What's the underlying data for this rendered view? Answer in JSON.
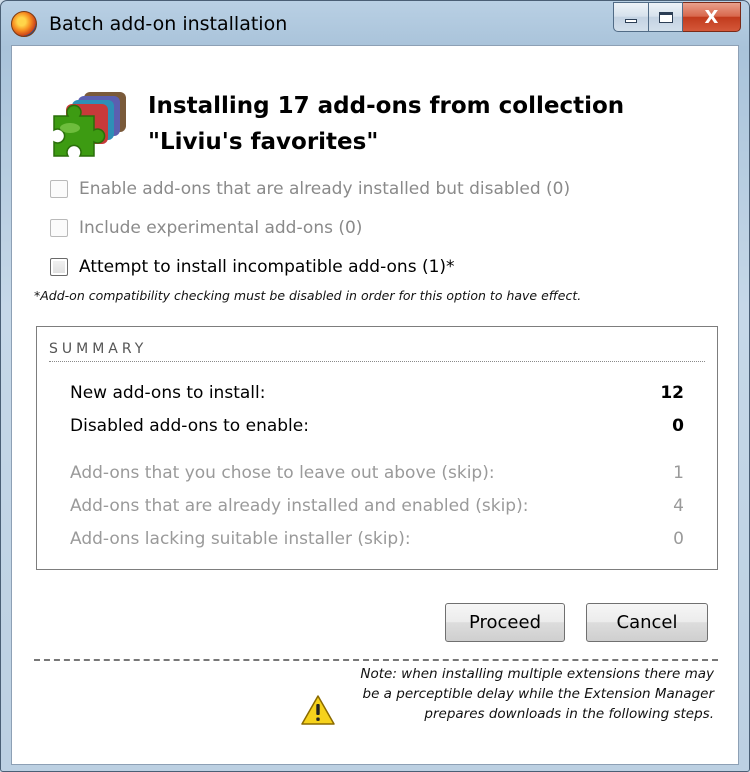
{
  "window": {
    "title": "Batch add-on installation",
    "minimize_label": "",
    "close_label": "X"
  },
  "header": {
    "line1": "Installing 17 add-ons from collection",
    "line2": "\"Liviu's favorites\""
  },
  "options": [
    {
      "label": "Enable add-ons that are already installed but disabled (0)",
      "enabled": false,
      "checked": false
    },
    {
      "label": "Include experimental add-ons (0)",
      "enabled": false,
      "checked": false
    },
    {
      "label": "Attempt to install incompatible add-ons (1)*",
      "enabled": true,
      "checked": false
    }
  ],
  "note": "*Add-on compatibility checking must be disabled in order for this option to have effect.",
  "summary": {
    "title": "SUMMARY",
    "rows": [
      {
        "label": "New add-ons to install:",
        "value": "12"
      },
      {
        "label": "Disabled add-ons to enable:",
        "value": "0"
      },
      {
        "label": "Add-ons that you chose to leave out above (skip):",
        "value": "1"
      },
      {
        "label": "Add-ons that are already installed and enabled (skip):",
        "value": "4"
      },
      {
        "label": "Add-ons lacking suitable installer (skip):",
        "value": "0"
      }
    ]
  },
  "buttons": {
    "proceed": "Proceed",
    "cancel": "Cancel"
  },
  "footnote": "Note: when installing multiple extensions there may be a perceptible delay while the Extension Manager prepares downloads in the following steps.",
  "colors": {
    "puzzle_green": "#3d9b12",
    "warning_yellow": "#f6d21c"
  },
  "icons": {
    "app": "firefox-icon",
    "header": "add-ons-puzzle-icon",
    "warning": "warning-icon"
  }
}
